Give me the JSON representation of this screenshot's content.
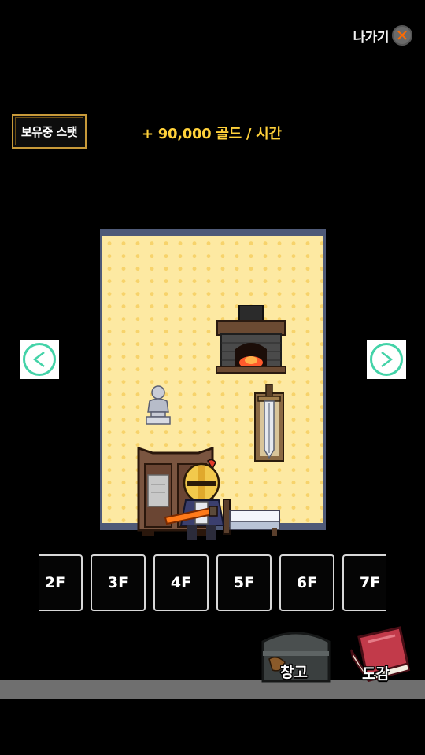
{
  "header": {
    "exit_label": "나가기",
    "exit_icon": "close-icon"
  },
  "stats": {
    "button_label": "보유중 스탯",
    "gold_rate": "+ 90,000 골드 / 시간"
  },
  "room": {
    "items": [
      "fireplace",
      "bust-statue",
      "sword-display",
      "wardrobe",
      "bed",
      "knight-character"
    ]
  },
  "nav": {
    "prev_icon": "chevron-left-icon",
    "next_icon": "chevron-right-icon",
    "accent_color": "#43d3a8"
  },
  "floors": [
    "2F",
    "3F",
    "4F",
    "5F",
    "6F",
    "7F"
  ],
  "bottom": {
    "storage_label": "창고",
    "collection_label": "도감"
  },
  "colors": {
    "gold_text": "#ffd13a",
    "frame": "#c89a3a",
    "wall": "#fde9a2",
    "wall_border": "#4f5a78"
  }
}
